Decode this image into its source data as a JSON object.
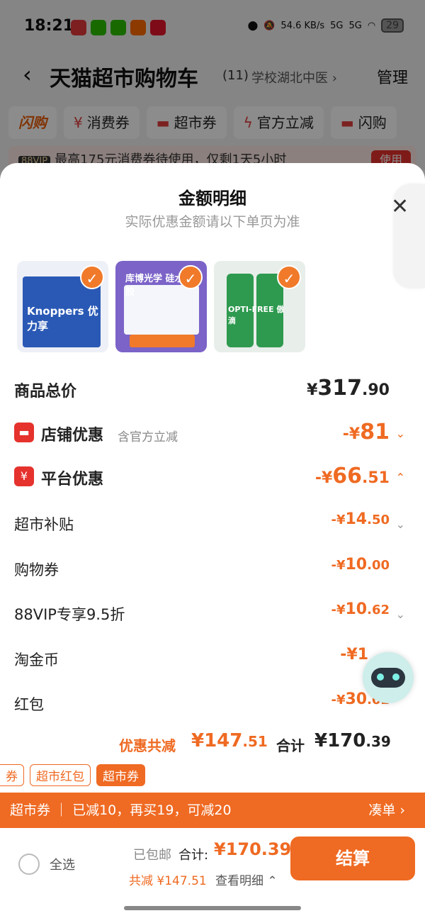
{
  "status": {
    "time": "18:21",
    "net_speed": "54.6 KB/s",
    "net": "5G",
    "battery": "29"
  },
  "header": {
    "back": "‹",
    "title": "天猫超市购物车",
    "count": "(11)",
    "location": "学校湖北中医 ›",
    "manage": "管理"
  },
  "chips": [
    {
      "icon": "",
      "label": "闪购"
    },
    {
      "icon": "¥",
      "label": "消费券"
    },
    {
      "icon": "▬",
      "label": "超市券"
    },
    {
      "icon": "ϟ",
      "label": "官方立减"
    },
    {
      "icon": "▬",
      "label": "闪购"
    }
  ],
  "vip_bar": {
    "badge": "88VIP",
    "text": "最高175元消费券待使用，仅剩1天5小时",
    "action": "使用"
  },
  "sheet": {
    "title": "金额明细",
    "subtitle": "实际优惠金额请以下单页为准",
    "close": "✕",
    "products": [
      {
        "name": "Knoppers 优力享",
        "check": "✓"
      },
      {
        "name": "库博光学 硅水凝胶",
        "check": "✓"
      },
      {
        "name": "OPTI-FREE 傲滴",
        "check": "✓"
      }
    ],
    "rows": {
      "total": {
        "label": "商品总价",
        "yuan": "¥",
        "int": "317",
        "dec": ".90"
      },
      "shop": {
        "icon": "▬",
        "label": "店铺优惠",
        "note": "含官方立减",
        "prefix": "-¥",
        "int": "81",
        "dec": "",
        "arrow": "⌄"
      },
      "platform": {
        "icon": "¥",
        "label": "平台优惠",
        "prefix": "-¥",
        "int": "66",
        "dec": ".51",
        "arrow": "⌃"
      },
      "subsidy": {
        "label": "超市补贴",
        "prefix": "-¥",
        "int": "14",
        "dec": ".50",
        "arrow": "⌄"
      },
      "coupon": {
        "label": "购物券",
        "prefix": "-¥",
        "int": "10",
        "dec": ".00"
      },
      "vip": {
        "label": "88VIP专享9.5折",
        "prefix": "-¥",
        "int": "10",
        "dec": ".62",
        "arrow": "⌄"
      },
      "coin": {
        "label": "淘金币",
        "prefix": "-¥1"
      },
      "redpack": {
        "label": "红包",
        "prefix": "-¥",
        "int": "30",
        "dec": ".02"
      }
    },
    "summary": {
      "discount_label": "优惠共减",
      "discount_int": "¥147",
      "discount_dec": ".51",
      "total_label": "合计",
      "total_int": "¥170",
      "total_dec": ".39"
    }
  },
  "tags": [
    "券",
    "超市红包",
    "超市券"
  ],
  "coupon_bar": {
    "left": "超市券 ｜ 已减10，再买19，可减20",
    "right": "凑单 ›"
  },
  "footer": {
    "select_all": "全选",
    "shipping": "已包邮",
    "total_label": "合计:",
    "total": "¥170.39",
    "saved": "共减 ¥147.51",
    "detail": "查看明细 ⌃",
    "pay": "结算"
  }
}
